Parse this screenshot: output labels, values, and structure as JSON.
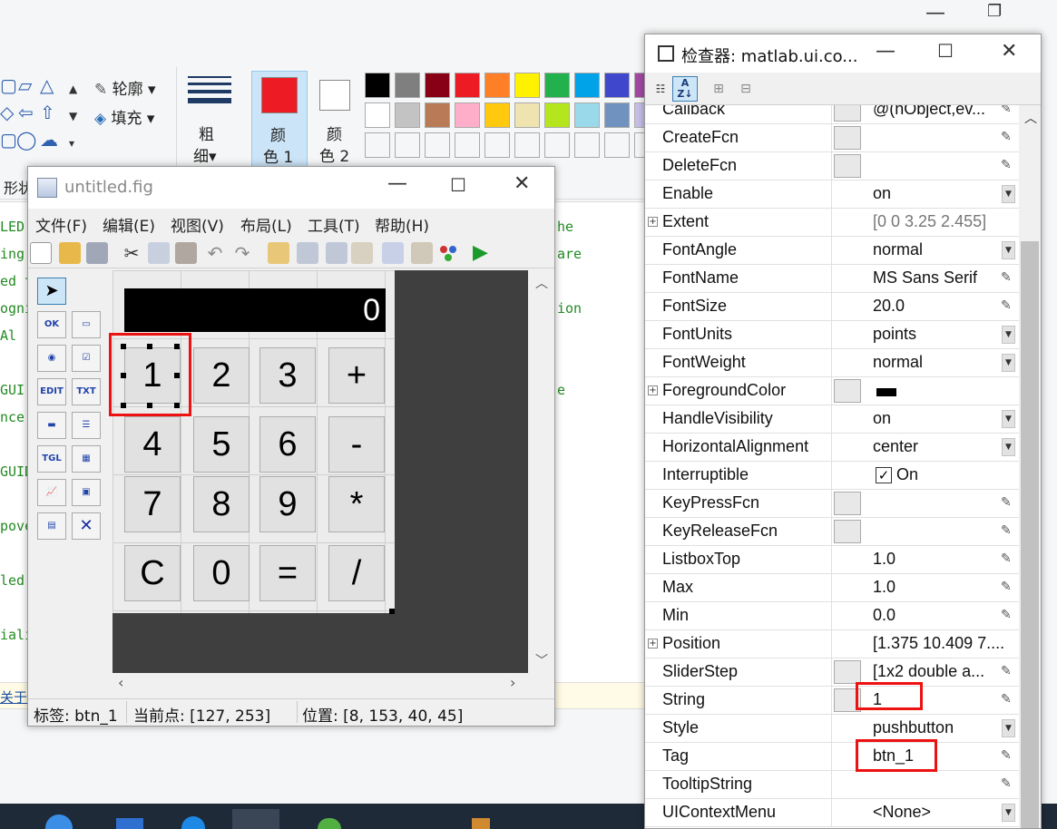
{
  "paint": {
    "ribbon": {
      "outline_label": "轮廓",
      "fill_label": "填充",
      "thickness_label_1": "粗",
      "thickness_label_2": "细",
      "color1_label_1": "颜",
      "color1_label_2": "色 1",
      "color2_label_1": "颜",
      "color2_label_2": "色 2",
      "shapes_group_label": "形状",
      "color1": "#ed1c24",
      "color2": "#ffffff",
      "palette": [
        "#000000",
        "#7f7f7f",
        "#880015",
        "#ed1c24",
        "#ff7f27",
        "#fff200",
        "#22b14c",
        "#00a2e8",
        "#3f48cc",
        "#a349a4",
        "#ffffff",
        "#c3c3c3",
        "#b97a57",
        "#ffaec9",
        "#ffc90e",
        "#efe4b0",
        "#b5e61d",
        "#99d9ea",
        "#7092be",
        "#c8bfe7"
      ]
    },
    "code_lines": [
      "LED(",
      "ing",
      "ed t",
      "ogni",
      "  Al",
      "GUI",
      "nce",
      "GUID",
      "pove",
      "led",
      "iali"
    ],
    "code_right": [
      "he",
      "are",
      "ion",
      "e"
    ],
    "bottom_text": "关于"
  },
  "guide": {
    "title": "untitled.fig",
    "menu": [
      "文件(F)",
      "编辑(E)",
      "视图(V)",
      "布局(L)",
      "工具(T)",
      "帮助(H)"
    ],
    "display_value": "0",
    "buttons": [
      "1",
      "2",
      "3",
      "+",
      "4",
      "5",
      "6",
      "-",
      "7",
      "8",
      "9",
      "*",
      "C",
      "0",
      "=",
      "/"
    ],
    "status": {
      "tag": "标签: btn_1",
      "current_point": "当前点:  [127, 253]",
      "position": "位置: [8, 153, 40, 45]"
    },
    "palette_labels": [
      "OK",
      "",
      "",
      "",
      "EDIT",
      "TXT",
      "",
      "",
      "TGL",
      "",
      "",
      "",
      "",
      ""
    ]
  },
  "inspector": {
    "title": "检查器:  matlab.ui.co...",
    "properties": [
      {
        "name": "Callback",
        "value": "@(hObject,ev...",
        "btn": true,
        "ctrl": "pencil"
      },
      {
        "name": "CreateFcn",
        "value": "",
        "btn": true,
        "ctrl": "pencil"
      },
      {
        "name": "DeleteFcn",
        "value": "",
        "btn": true,
        "ctrl": "pencil"
      },
      {
        "name": "Enable",
        "value": "on",
        "ctrl": "dropdown"
      },
      {
        "name": "Extent",
        "value": "[0 0 3.25 2.455]",
        "expand": true,
        "dim": true
      },
      {
        "name": "FontAngle",
        "value": "normal",
        "ctrl": "dropdown"
      },
      {
        "name": "FontName",
        "value": "MS Sans Serif",
        "ctrl": "pencil"
      },
      {
        "name": "FontSize",
        "value": "20.0",
        "ctrl": "pencil"
      },
      {
        "name": "FontUnits",
        "value": "points",
        "ctrl": "dropdown"
      },
      {
        "name": "FontWeight",
        "value": "normal",
        "ctrl": "dropdown"
      },
      {
        "name": "ForegroundColor",
        "value": "",
        "expand": true,
        "btn": true,
        "swatch": "#000000"
      },
      {
        "name": "HandleVisibility",
        "value": "on",
        "ctrl": "dropdown"
      },
      {
        "name": "HorizontalAlignment",
        "value": "center",
        "ctrl": "dropdown"
      },
      {
        "name": "Interruptible",
        "value": "On",
        "checkbox": true
      },
      {
        "name": "KeyPressFcn",
        "value": "",
        "btn": true,
        "ctrl": "pencil"
      },
      {
        "name": "KeyReleaseFcn",
        "value": "",
        "btn": true,
        "ctrl": "pencil"
      },
      {
        "name": "ListboxTop",
        "value": "1.0",
        "ctrl": "pencil"
      },
      {
        "name": "Max",
        "value": "1.0",
        "ctrl": "pencil"
      },
      {
        "name": "Min",
        "value": "0.0",
        "ctrl": "pencil"
      },
      {
        "name": "Position",
        "value": "[1.375 10.409 7....",
        "expand": true
      },
      {
        "name": "SliderStep",
        "value": "[1x2  double a...",
        "btn": true,
        "ctrl": "pencil"
      },
      {
        "name": "String",
        "value": "1",
        "btn": true,
        "ctrl": "pencil"
      },
      {
        "name": "Style",
        "value": "pushbutton",
        "ctrl": "dropdown"
      },
      {
        "name": "Tag",
        "value": "btn_1",
        "ctrl": "pencil"
      },
      {
        "name": "TooltipString",
        "value": "",
        "ctrl": "pencil"
      },
      {
        "name": "UIContextMenu",
        "value": "<None>",
        "ctrl": "dropdown"
      }
    ]
  },
  "colors": {
    "highlight_red": "#e11111",
    "taskbar": "#1e2a38"
  }
}
